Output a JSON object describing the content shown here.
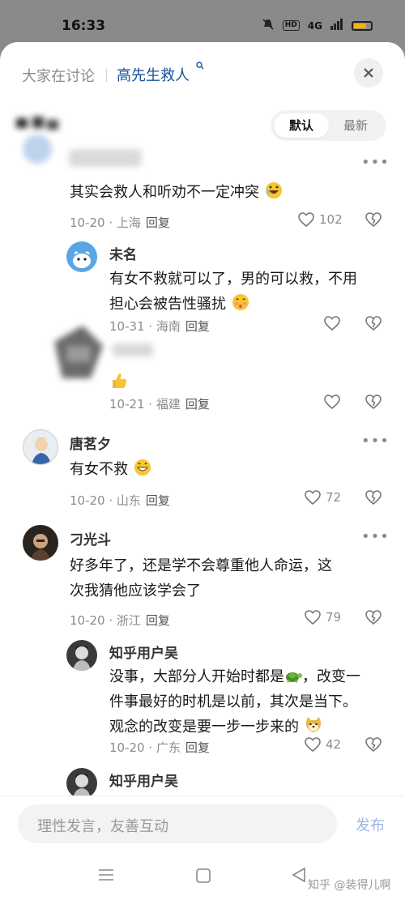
{
  "status": {
    "time": "16:33",
    "network": "4G",
    "hd": "HD"
  },
  "header": {
    "title": "大家在讨论",
    "topic": "高先生救人"
  },
  "sort": {
    "default": "默认",
    "latest": "最新"
  },
  "comments": [
    {
      "content": "其实会救人和听劝不一定冲突",
      "date": "10-20",
      "location": "上海",
      "reply": "回复",
      "likes": "102"
    },
    {
      "user": "未名",
      "content_line1": "有女不救就可以了，男的可以救，不用",
      "content_line2": "担心会被告性骚扰",
      "date": "10-31",
      "location": "海南",
      "reply": "回复"
    },
    {
      "date": "10-21",
      "location": "福建",
      "reply": "回复"
    },
    {
      "user": "唐茗夕",
      "content": "有女不救",
      "date": "10-20",
      "location": "山东",
      "reply": "回复",
      "likes": "72"
    },
    {
      "user": "刁光斗",
      "content_line1": "好多年了，还是学不会尊重他人命运，这",
      "content_line2": "次我猜他应该学会了",
      "date": "10-20",
      "location": "浙江",
      "reply": "回复",
      "likes": "79"
    },
    {
      "user": "知乎用户吴",
      "content_line1": "没事，大部分人开始时都是",
      "content_line1b": "，改变一",
      "content_line2": "件事最好的时机是以前，其次是当下。",
      "content_line3": "观念的改变是要一步一步来的",
      "date": "10-20",
      "location": "广东",
      "reply": "回复",
      "likes": "42"
    },
    {
      "user": "知乎用户吴"
    }
  ],
  "input": {
    "placeholder": "理性发言，友善互动",
    "send": "发布"
  },
  "watermark": "知乎 @装得儿啊"
}
